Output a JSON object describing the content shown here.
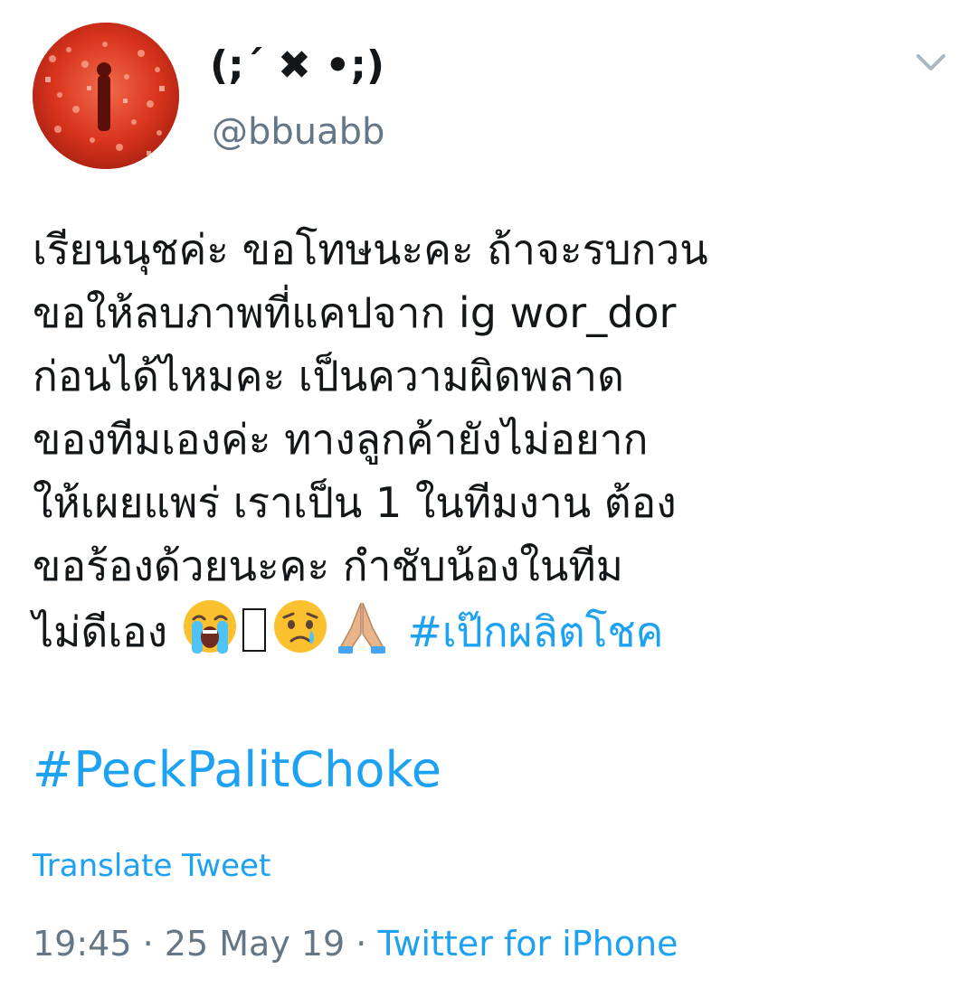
{
  "author": {
    "display_name": "(;´ ✖ •;)",
    "handle": "@bbuabb",
    "avatar": "avatar-image"
  },
  "icons": {
    "caret": "chevron-down-icon",
    "caret_color": "#aab8c2"
  },
  "tweet": {
    "lines": [
      "เรียนนุชค่ะ ขอโทษนะคะ ถ้าจะรบกวน",
      "ขอให้ลบภาพที่แคปจาก ig wor_dor",
      "ก่อนได้ไหมคะ เป็นความผิดพลาด",
      "ของทีมเองค่ะ ทางลูกค้ายังไม่อยาก",
      "ให้เผยแพร่ เราเป็น 1 ในทีมงาน ต้อง",
      "ขอร้องด้วยนะคะ กำชับน้องในทีม"
    ],
    "last_line_text": "ไม่ดีเอง",
    "emojis": [
      "crying-face-emoji",
      "missing-glyph",
      "sad-face-emoji",
      "folded-hands-emoji"
    ],
    "hashtag_thai": "#เป๊กผลิตโชค",
    "hashtag_en": "#PeckPalitChoke"
  },
  "translate_label": "Translate Tweet",
  "meta": {
    "time": "19:45",
    "separator": " · ",
    "date": "25 May 19",
    "source": "Twitter for iPhone"
  },
  "colors": {
    "link": "#1da1f2",
    "secondary_text": "#657786",
    "primary_text": "#14171a"
  }
}
